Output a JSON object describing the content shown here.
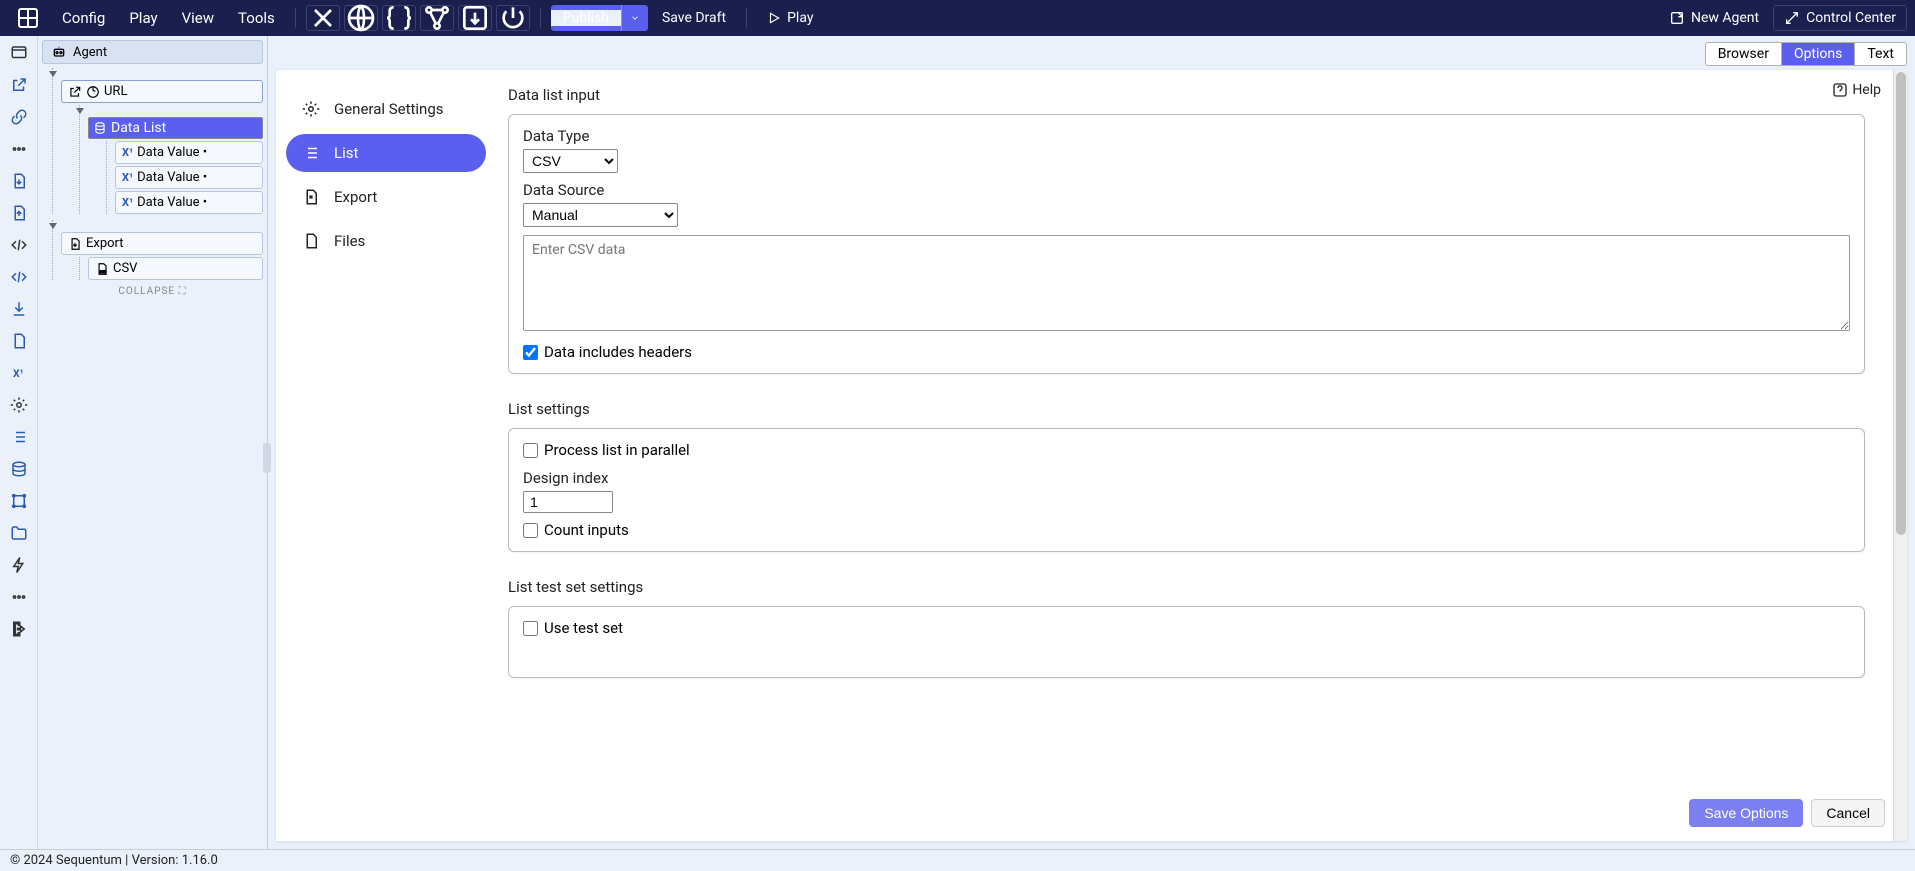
{
  "menubar": {
    "items": [
      "Config",
      "Play",
      "View",
      "Tools"
    ],
    "publish": "Publish",
    "save_draft": "Save Draft",
    "play": "Play",
    "new_agent": "New Agent",
    "control_center": "Control Center"
  },
  "tree": {
    "root": "Agent",
    "url": "URL",
    "data_list": "Data List",
    "data_values": [
      "Data Value •",
      "Data Value •",
      "Data Value •"
    ],
    "export": "Export",
    "csv": "CSV",
    "collapse": "COLLAPSE"
  },
  "seg": {
    "browser": "Browser",
    "options": "Options",
    "text": "Text"
  },
  "setnav": {
    "general": "General Settings",
    "list": "List",
    "export": "Export",
    "files": "Files"
  },
  "help": "Help",
  "form": {
    "s1_title": "Data list input",
    "data_type_label": "Data Type",
    "data_type_value": "CSV",
    "data_source_label": "Data Source",
    "data_source_value": "Manual",
    "csv_placeholder": "Enter CSV data",
    "headers_cb": "Data includes headers",
    "headers_checked": true,
    "s2_title": "List settings",
    "parallel_cb": "Process list in parallel",
    "design_index_label": "Design index",
    "design_index_value": "1",
    "count_cb": "Count inputs",
    "s3_title": "List test set settings",
    "testset_cb": "Use test set"
  },
  "buttons": {
    "save": "Save Options",
    "cancel": "Cancel"
  },
  "status": "© 2024 Sequentum | Version: 1.16.0"
}
